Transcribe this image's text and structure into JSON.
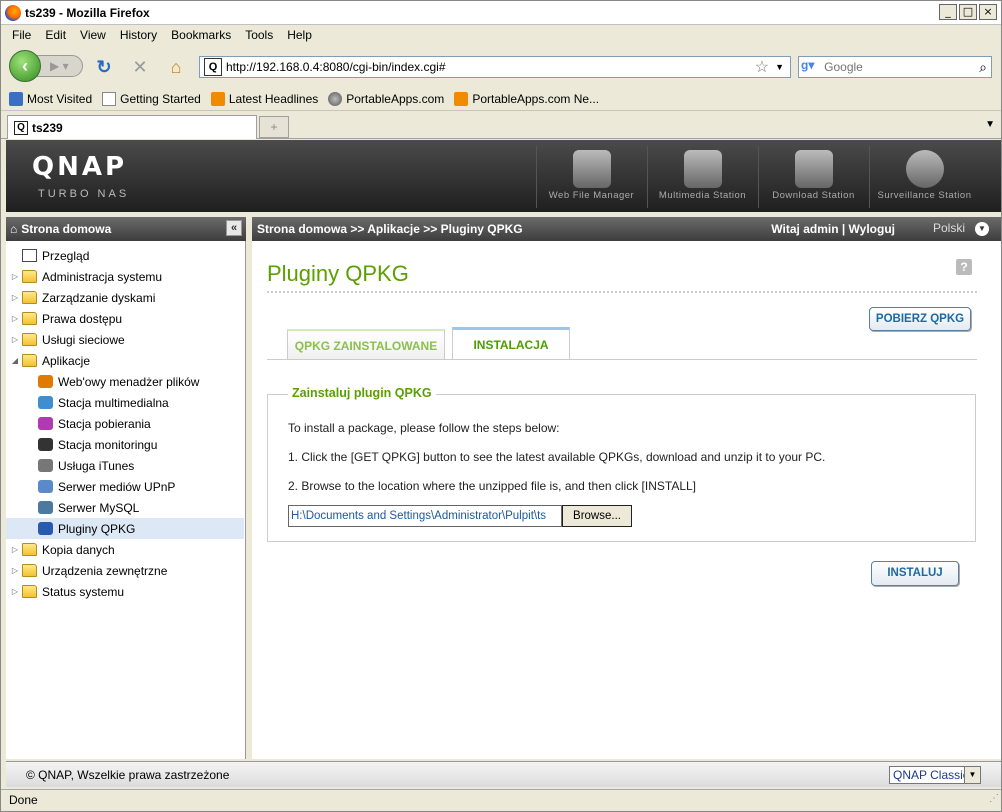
{
  "window": {
    "title": "ts239 - Mozilla Firefox"
  },
  "menu": [
    "File",
    "Edit",
    "View",
    "History",
    "Bookmarks",
    "Tools",
    "Help"
  ],
  "nav": {
    "url": "http://192.168.0.4:8080/cgi-bin/index.cgi#",
    "search_placeholder": "Google"
  },
  "bookmarks": [
    "Most Visited",
    "Getting Started",
    "Latest Headlines",
    "PortableApps.com",
    "PortableApps.com Ne..."
  ],
  "tab": {
    "label": "ts239"
  },
  "header": {
    "logo": "QNAP",
    "subtitle": "TURBO NAS",
    "apps": [
      "Web File Manager",
      "Multimedia Station",
      "Download Station",
      "Surveillance Station"
    ]
  },
  "left": {
    "title": "Strona domowa",
    "items": [
      {
        "label": "Przegląd",
        "level": 0,
        "arrow": ""
      },
      {
        "label": "Administracja systemu",
        "level": 0,
        "arrow": "▷"
      },
      {
        "label": "Zarządzanie dyskami",
        "level": 0,
        "arrow": "▷"
      },
      {
        "label": "Prawa dostępu",
        "level": 0,
        "arrow": "▷"
      },
      {
        "label": "Usługi sieciowe",
        "level": 0,
        "arrow": "▷"
      },
      {
        "label": "Aplikacje",
        "level": 0,
        "arrow": "◢"
      },
      {
        "label": "Web'owy menadżer plików",
        "level": 1,
        "arrow": ""
      },
      {
        "label": "Stacja multimedialna",
        "level": 1,
        "arrow": ""
      },
      {
        "label": "Stacja pobierania",
        "level": 1,
        "arrow": ""
      },
      {
        "label": "Stacja monitoringu",
        "level": 1,
        "arrow": ""
      },
      {
        "label": "Usługa iTunes",
        "level": 1,
        "arrow": ""
      },
      {
        "label": "Serwer mediów UPnP",
        "level": 1,
        "arrow": ""
      },
      {
        "label": "Serwer MySQL",
        "level": 1,
        "arrow": ""
      },
      {
        "label": "Pluginy QPKG",
        "level": 1,
        "arrow": "",
        "selected": true
      },
      {
        "label": "Kopia danych",
        "level": 0,
        "arrow": "▷"
      },
      {
        "label": "Urządzenia zewnętrzne",
        "level": 0,
        "arrow": "▷"
      },
      {
        "label": "Status systemu",
        "level": 0,
        "arrow": "▷"
      }
    ]
  },
  "main": {
    "breadcrumb": "Strona domowa >> Aplikacje >> Pluginy QPKG",
    "welcome": "Witaj admin | Wyloguj",
    "language": "Polski",
    "title": "Pluginy QPKG",
    "get_button": "POBIERZ QPKG",
    "tabs": [
      "QPKG ZAINSTALOWANE",
      "INSTALACJA"
    ],
    "active_tab": 1,
    "fieldset": {
      "legend": "Zainstaluj plugin QPKG",
      "line1": "To install a package, please follow the steps below:",
      "line2": "1. Click the [GET QPKG] button to see the latest available QPKGs, download and unzip it to your PC.",
      "line3": "2. Browse to the location where the unzipped file is, and then click [INSTALL]",
      "file_path": "H:\\Documents and Settings\\Administrator\\Pulpit\\ts",
      "browse_label": "Browse..."
    },
    "install_button": "INSTALUJ"
  },
  "footer": {
    "copyright": "© QNAP, Wszelkie prawa zastrzeżone",
    "skin": "QNAP Classic"
  },
  "statusbar": "Done"
}
